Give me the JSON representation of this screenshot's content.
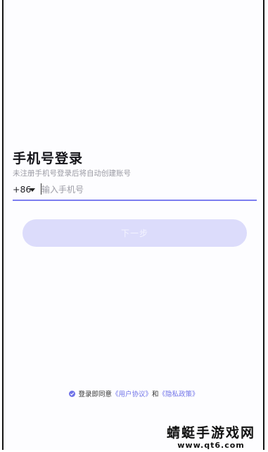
{
  "login": {
    "title": "手机号登录",
    "subtitle": "未注册手机号登录后将自动创建账号",
    "country_code": "+86",
    "phone_placeholder": "输入手机号",
    "phone_value": "",
    "next_label": "下一步"
  },
  "agreement": {
    "prefix": "登录即同意",
    "user_agreement": "《用户协议》",
    "and": "和",
    "privacy_policy": "《隐私政策》",
    "checked": true
  },
  "watermark": {
    "text": "蜻蜓手游戏网",
    "url": "www.qt6.com"
  },
  "colors": {
    "accent": "#6f72e8",
    "button_disabled": "#dcdcfb",
    "underline": "#7c7ef0"
  },
  "icons": [
    "chevron-down-icon",
    "check-circle-icon"
  ]
}
